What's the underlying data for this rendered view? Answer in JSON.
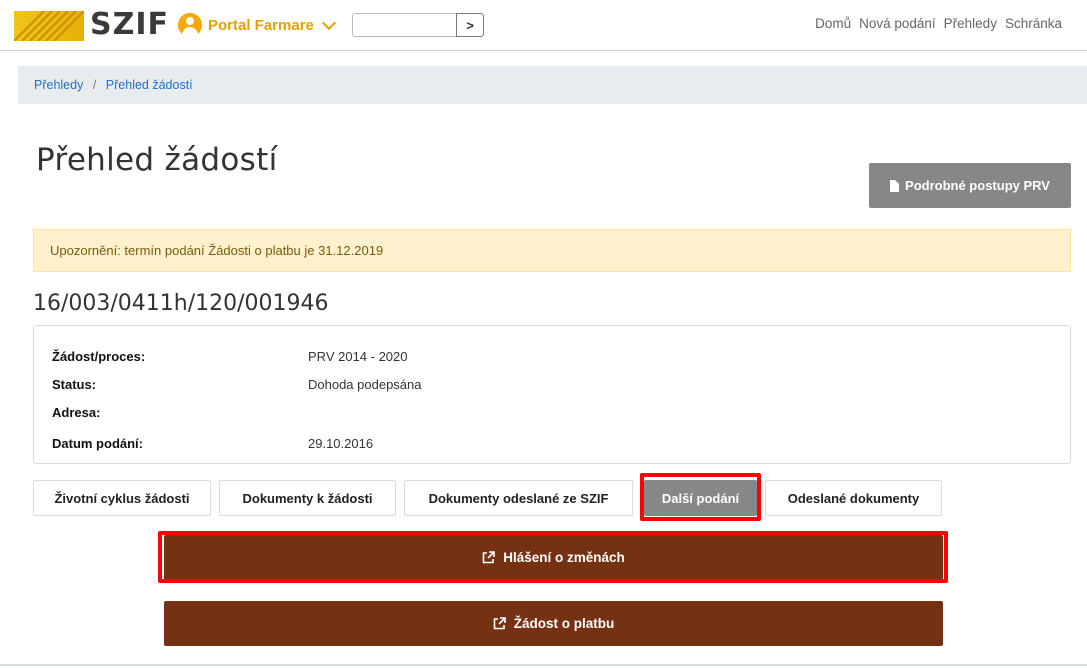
{
  "header": {
    "logo_text": "SZIF",
    "portal_label": "Portal Farmare",
    "search": {
      "value": "",
      "placeholder": ""
    },
    "search_button_glyph": ">",
    "nav": [
      "Domů",
      "Nová podání",
      "Přehledy",
      "Schránka"
    ]
  },
  "breadcrumb": {
    "items": [
      "Přehledy",
      "Přehled žádostí"
    ],
    "separator": "/"
  },
  "page": {
    "title": "Přehled žádostí",
    "pdf_button": "Podrobné postupy PRV",
    "alert": "Upozornění: termín podání Žádosti o platbu je 31.12.2019",
    "application_id": "16/003/0411h/120/001946"
  },
  "details": [
    {
      "label": "Žádost/proces:",
      "value": "PRV 2014 - 2020"
    },
    {
      "label": "Status:",
      "value": "Dohoda podepsána"
    },
    {
      "label": "Adresa:",
      "value": ""
    },
    {
      "label": "Datum podání:",
      "value": "29.10.2016"
    }
  ],
  "tabs": [
    {
      "label": "Životní cyklus žádosti",
      "active": false
    },
    {
      "label": "Dokumenty k žádosti",
      "active": false
    },
    {
      "label": "Dokumenty odeslané ze SZIF",
      "active": false
    },
    {
      "label": "Další podání",
      "active": true
    },
    {
      "label": "Odeslané dokumenty",
      "active": false
    }
  ],
  "actions": [
    {
      "label": "Hlášení o změnách",
      "icon": "external-link-icon",
      "highlighted": true
    },
    {
      "label": "Žádost o platbu",
      "icon": "external-link-icon",
      "highlighted": false
    }
  ],
  "colors": {
    "brand_yellow": "#f0c419",
    "action_brown": "#743213",
    "highlight_red": "#ff0000",
    "active_tab_gray": "#878787",
    "alert_bg": "#fdf2cd",
    "link_blue": "#1a73c8"
  }
}
